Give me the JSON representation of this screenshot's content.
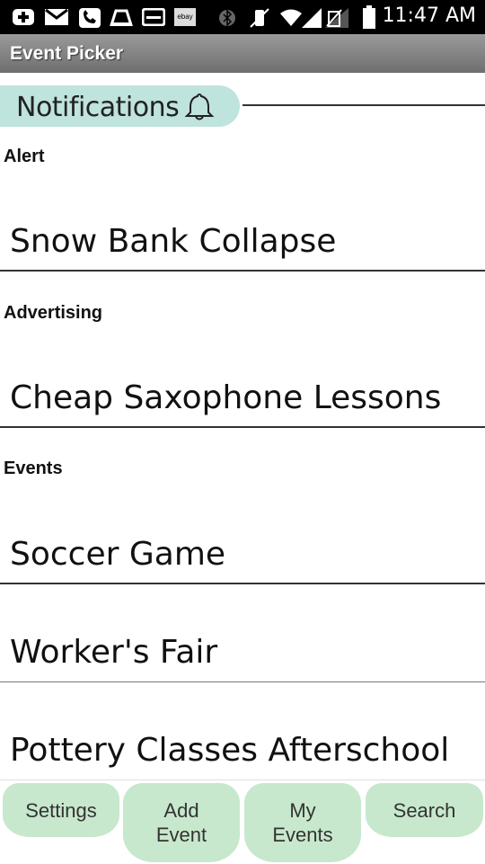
{
  "status_bar": {
    "time": "11:47 AM",
    "icons": [
      "plus-icon",
      "mail-icon",
      "voicemail-icon",
      "cloud-upload-icon",
      "inbox-icon",
      "ebay-icon",
      "bluetooth-icon",
      "vibrate-off-icon",
      "wifi-icon",
      "signal-icon",
      "no-sim-icon",
      "battery-icon"
    ],
    "ebay_label": "ebay"
  },
  "app": {
    "title": "Event Picker"
  },
  "header": {
    "label": "Notifications",
    "icon": "bell-icon",
    "accent": "#bfe3dd"
  },
  "sections": [
    {
      "title": "Alert",
      "items": [
        "Snow Bank Collapse"
      ]
    },
    {
      "title": "Advertising",
      "items": [
        "Cheap Saxophone Lessons"
      ]
    },
    {
      "title": "Events",
      "items": [
        "Soccer Game",
        "Worker's Fair",
        "Pottery Classes Afterschool"
      ]
    }
  ],
  "nav": {
    "accent": "#c7e8cc",
    "buttons": [
      {
        "label": "Settings"
      },
      {
        "label_line1": "Add",
        "label_line2": "Event"
      },
      {
        "label_line1": "My",
        "label_line2": "Events"
      },
      {
        "label": "Search"
      }
    ]
  }
}
